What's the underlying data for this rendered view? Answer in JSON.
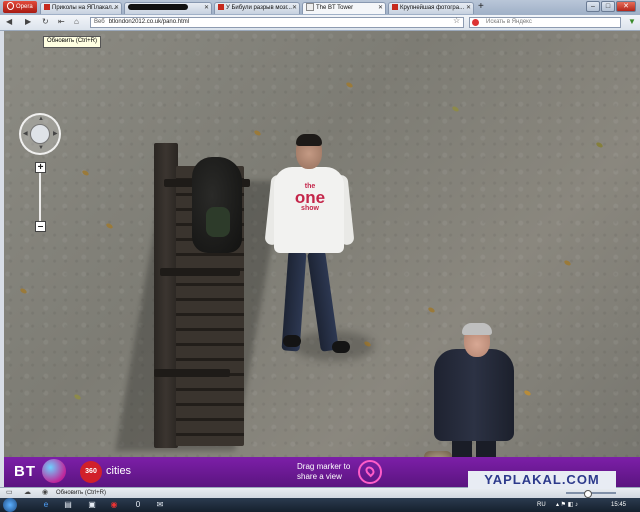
{
  "browser": {
    "menu_label": "Opera",
    "tabs": [
      {
        "label": "Приколы на ЯПлакал..."
      },
      {
        "label": ""
      },
      {
        "label": "У Бибули разрыв мозг..."
      },
      {
        "label": "The BT Tower"
      },
      {
        "label": "Крупнейшая фотогра..."
      }
    ],
    "new_tab": "+",
    "window_controls": {
      "minimize": "–",
      "maximize": "□",
      "close": "✕"
    },
    "address": {
      "site_label": "Веб",
      "url": "btlondon2012.co.uk/pano.html"
    },
    "search_placeholder": "Искать в Яндекс",
    "tooltip": "Обновить (Ctrl+R)"
  },
  "panorama": {
    "shirt_text": {
      "line1": "the",
      "line2": "one",
      "line3": "show"
    }
  },
  "banner": {
    "bt_logo": "BT",
    "badge_360": "360",
    "cities": "cities",
    "drag_line1": "Drag marker to",
    "drag_line2": "share a view"
  },
  "watermark": "YAPLAKAL.COM",
  "statusbar": {
    "text": "Обновить (Ctrl+R)"
  },
  "taskbar": {
    "lang": "RU",
    "time": "15:45"
  },
  "colors": {
    "banner": "#6a1a92",
    "marker": "#ff5cc8",
    "badge_360": "#d1202a"
  }
}
